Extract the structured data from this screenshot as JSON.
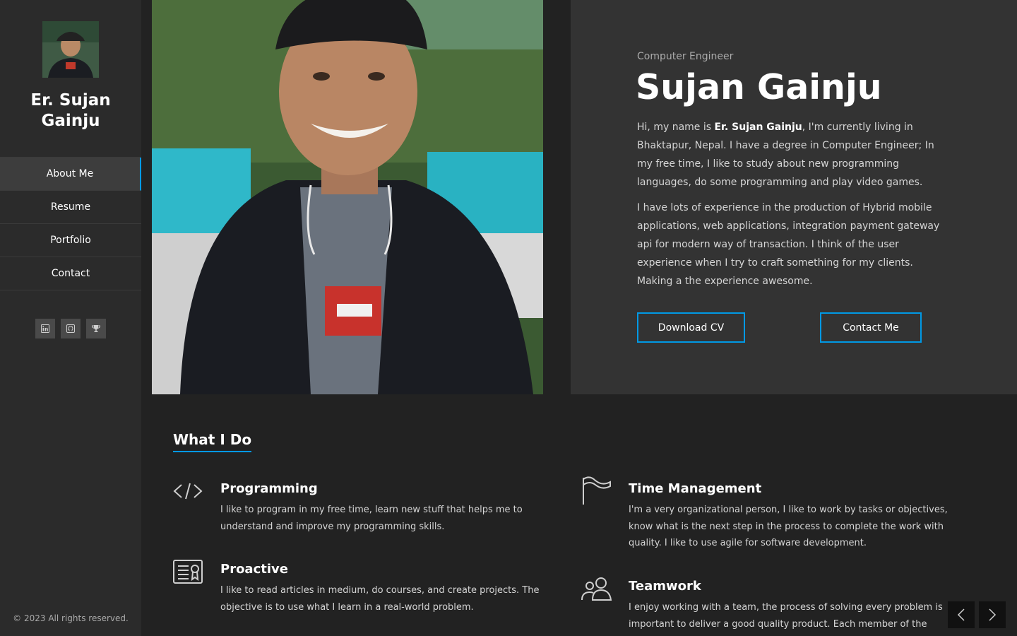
{
  "sidebar": {
    "site_name": "Er. Sujan Gainju",
    "nav": [
      {
        "label": "About Me",
        "active": true
      },
      {
        "label": "Resume"
      },
      {
        "label": "Portfolio"
      },
      {
        "label": "Contact"
      }
    ],
    "social_icons": [
      "linkedin-icon",
      "github-icon",
      "trophy-icon"
    ],
    "copyright": "© 2023 All rights reserved."
  },
  "hero": {
    "subtitle": "Computer Engineer",
    "name": "Sujan Gainju",
    "intro_prefix": "Hi, my name is ",
    "intro_name": "Er. Sujan Gainju",
    "intro_rest": ", I'm currently living in Bhaktapur, Nepal. I have a degree in Computer Engineer; In my free time, I like to study about new programming languages, do some programming and play video games.",
    "intro_2": "I have lots of experience in the production of Hybrid mobile applications, web applications, integration payment gateway api for modern way of transaction. I think of the user experience when I try to craft something for my clients. Making a the experience awesome.",
    "download_cv": "Download CV",
    "contact_me": "Contact Me"
  },
  "what_i_do": {
    "title": "What I Do",
    "services": [
      {
        "title": "Programming",
        "text": "I like to program in my free time, learn new stuff that helps me to understand and improve my programming skills.",
        "icon": "code-icon"
      },
      {
        "title": "Time Management",
        "text": "I'm a very organizational person, I like to work by tasks or objectives, know what is the next step in the process to complete the work with quality. I like to use agile for software development.",
        "icon": "flag-icon"
      },
      {
        "title": "Proactive",
        "text": "I like to read articles in medium, do courses, and create projects. The objective is to use what I learn in a real-world problem.",
        "icon": "certificate-icon"
      },
      {
        "title": "Teamwork",
        "text": "I enjoy working with a team, the process of solving every problem is important to deliver a good quality product. Each member of the team",
        "icon": "users-icon"
      }
    ]
  },
  "colors": {
    "accent": "#0099e5",
    "bg": "#222222",
    "sidebar": "#2b2b2b",
    "panel": "#333333"
  }
}
